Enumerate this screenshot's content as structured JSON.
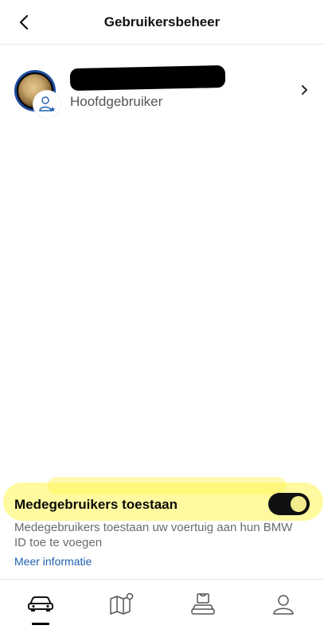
{
  "header": {
    "title": "Gebruikersbeheer",
    "back_icon": "chevron-left-icon"
  },
  "main_user": {
    "name": "",
    "role": "Hoofdgebruiker",
    "badge_icon": "user-star-icon",
    "chevron_icon": "chevron-right-icon"
  },
  "co_users": {
    "title": "Medegebruikers toestaan",
    "enabled": true,
    "description": "Medegebruikers toestaan uw voertuig aan hun BMW ID toe te voegen",
    "link": "Meer informatie"
  },
  "tabbar": {
    "tabs": [
      {
        "id": "vehicle",
        "icon": "car-icon",
        "active": true
      },
      {
        "id": "map",
        "icon": "map-icon",
        "active": false
      },
      {
        "id": "shop",
        "icon": "shop-car-icon",
        "active": false
      },
      {
        "id": "profile",
        "icon": "profile-icon",
        "active": false
      }
    ]
  },
  "colors": {
    "accent_link": "#1d5fae",
    "highlight": "#fff550",
    "toggle_on": "#111111",
    "avatar_ring": "#1c4a9c"
  }
}
